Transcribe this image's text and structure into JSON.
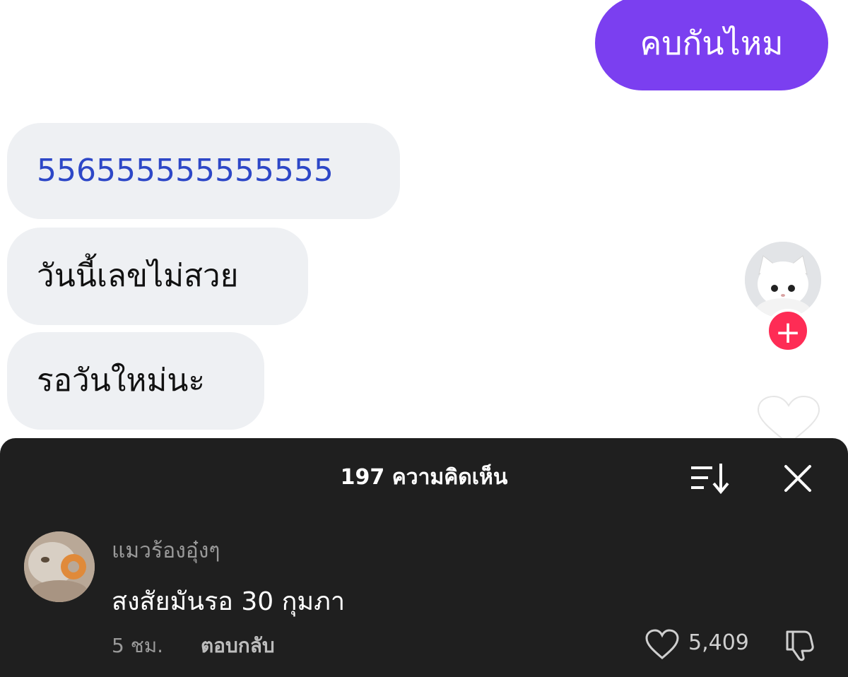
{
  "chat": {
    "outgoing": [
      {
        "text": "คบกันไหม"
      }
    ],
    "incoming": [
      {
        "text": "556555555555555"
      },
      {
        "text": "วันนี้เลขไม่สวย"
      },
      {
        "text": "รอวันใหม่นะ"
      }
    ]
  },
  "side": {
    "follow_symbol": "+",
    "avatar_icon": "cat-avatar-icon",
    "like_icon": "heart-icon"
  },
  "comments_panel": {
    "title": "197 ความคิดเห็น",
    "sort_icon": "sort-icon",
    "close_icon": "close-icon",
    "comments": [
      {
        "username": "แมวร้องอุ๋งๆ",
        "text": "สงสัยมันรอ 30 กุมภา",
        "time": "5 ชม.",
        "reply_label": "ตอบกลับ",
        "likes": "5,409"
      }
    ]
  },
  "colors": {
    "outgoing_bubble": "#7b3ff0",
    "incoming_bubble": "#eef0f3",
    "link_text": "#2d47c7",
    "follow_button": "#fe2c55",
    "panel_bg": "#1f1f1f"
  }
}
